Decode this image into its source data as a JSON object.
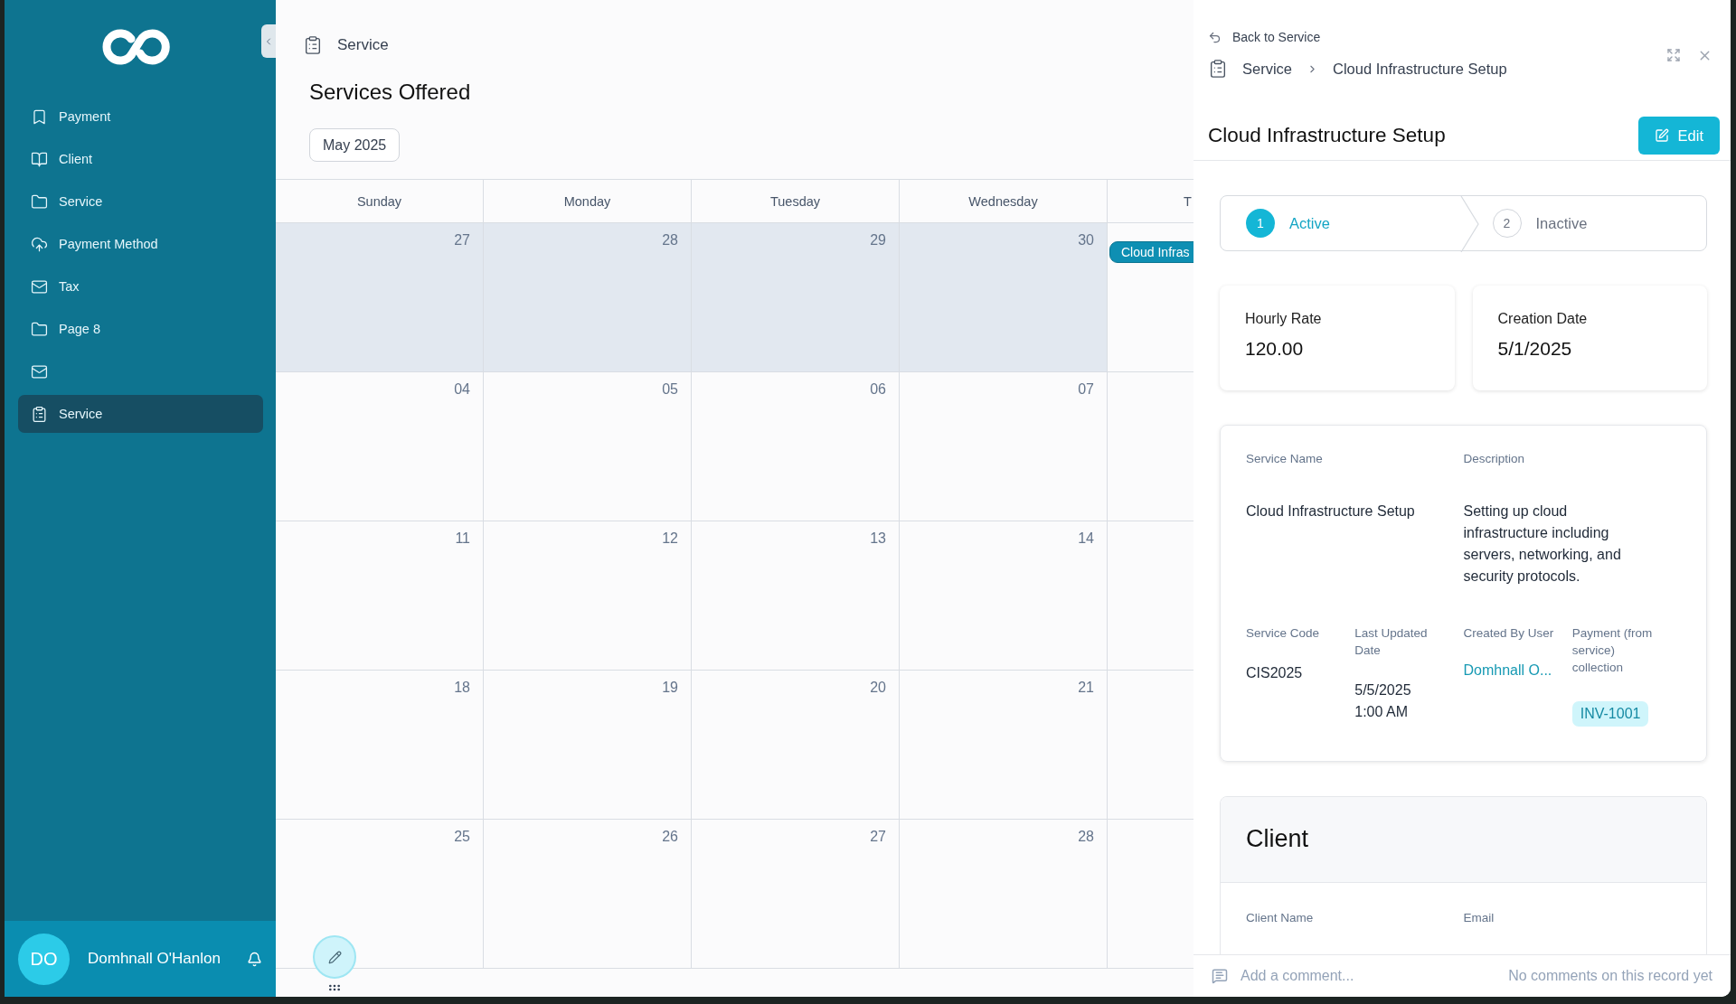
{
  "sidebar": {
    "items": [
      {
        "label": "Payment",
        "selected": false
      },
      {
        "label": "Client",
        "selected": false
      },
      {
        "label": "Service",
        "selected": false
      },
      {
        "label": "Payment Method",
        "selected": false
      },
      {
        "label": "Tax",
        "selected": false
      },
      {
        "label": "Page 8",
        "selected": false
      },
      {
        "selected": false
      },
      {
        "label": "Service",
        "selected": true
      }
    ]
  },
  "user": {
    "initials": "DO",
    "name": "Domhnall O'Hanlon"
  },
  "page": {
    "breadcrumb": "Service",
    "title": "Services Offered",
    "month": "May 2025"
  },
  "calendar": {
    "weekdays": [
      "Sunday",
      "Monday",
      "Tuesday",
      "Wednesday",
      "T"
    ],
    "weeks": [
      {
        "days": [
          {
            "date": "27",
            "outside_month": true
          },
          {
            "date": "28",
            "outside_month": true
          },
          {
            "date": "29",
            "outside_month": true
          },
          {
            "date": "30",
            "outside_month": true
          },
          {
            "outside_month": false,
            "events": [
              "Cloud Infras"
            ]
          }
        ]
      },
      {
        "days": [
          {
            "date": "04",
            "outside_month": false
          },
          {
            "date": "05",
            "outside_month": false
          },
          {
            "date": "06",
            "outside_month": false
          },
          {
            "date": "07",
            "outside_month": false
          },
          {
            "outside_month": false
          }
        ]
      },
      {
        "days": [
          {
            "date": "11",
            "outside_month": false
          },
          {
            "date": "12",
            "outside_month": false
          },
          {
            "date": "13",
            "outside_month": false
          },
          {
            "date": "14",
            "outside_month": false
          },
          {
            "outside_month": false
          }
        ]
      },
      {
        "days": [
          {
            "date": "18",
            "outside_month": false
          },
          {
            "date": "19",
            "outside_month": false
          },
          {
            "date": "20",
            "outside_month": false
          },
          {
            "date": "21",
            "outside_month": false
          },
          {
            "outside_month": false
          }
        ]
      },
      {
        "days": [
          {
            "date": "25",
            "outside_month": false
          },
          {
            "date": "26",
            "outside_month": false
          },
          {
            "date": "27",
            "outside_month": false
          },
          {
            "date": "28",
            "outside_month": false
          },
          {
            "outside_month": false
          }
        ]
      }
    ]
  },
  "panel": {
    "back_link": "Back to Service",
    "breadcrumb": [
      "Service",
      "Cloud Infrastructure Setup"
    ],
    "title": "Cloud Infrastructure Setup",
    "edit_button": "Edit",
    "steps": [
      {
        "number": "1",
        "label": "Active",
        "selected": true
      },
      {
        "number": "2",
        "label": "Inactive",
        "selected": false
      }
    ],
    "stats": [
      {
        "label": "Hourly Rate",
        "value": "120.00"
      },
      {
        "label": "Creation Date",
        "value": "5/1/2025"
      }
    ],
    "details": {
      "wide_fields": [
        {
          "label": "Service Name",
          "value": "Cloud Infrastructure Setup"
        },
        {
          "label": "Description",
          "value": "Setting up cloud infrastructure including servers, networking, and security protocols."
        }
      ],
      "fields": [
        {
          "label": "Service Code",
          "value": "CIS2025",
          "kind": "text"
        },
        {
          "label": "Last Updated Date",
          "value": "5/5/2025 1:00 AM",
          "kind": "text"
        },
        {
          "label": "Created By User",
          "value": "Domhnall O...",
          "kind": "link"
        },
        {
          "label": "Payment (from service) collection",
          "value": "INV-1001",
          "kind": "tag"
        }
      ]
    },
    "client": {
      "title": "Client",
      "fields": [
        "Client Name",
        "Email"
      ]
    },
    "comment": {
      "placeholder": "Add a comment...",
      "status": "No comments on this record yet"
    }
  }
}
